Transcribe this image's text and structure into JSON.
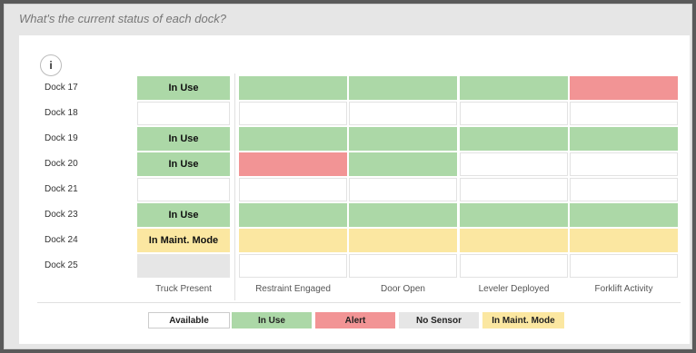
{
  "question": "What's the current status of each dock?",
  "info_icon_glyph": "i",
  "docks": [
    {
      "label": "Dock 17",
      "truck_status": "In Use"
    },
    {
      "label": "Dock 18",
      "truck_status": ""
    },
    {
      "label": "Dock 19",
      "truck_status": "In Use"
    },
    {
      "label": "Dock 20",
      "truck_status": "In Use"
    },
    {
      "label": "Dock 21",
      "truck_status": ""
    },
    {
      "label": "Dock 23",
      "truck_status": "In Use"
    },
    {
      "label": "Dock 24",
      "truck_status": "In Maint. Mode"
    },
    {
      "label": "Dock 25",
      "truck_status": ""
    }
  ],
  "columns": [
    "Truck Present",
    "Restraint Engaged",
    "Door Open",
    "Leveler Deployed",
    "Forklift Activity"
  ],
  "grid_states": [
    [
      "in_use",
      "in_use",
      "in_use",
      "in_use",
      "alert"
    ],
    [
      "available",
      "available",
      "available",
      "available",
      "available"
    ],
    [
      "in_use",
      "in_use",
      "in_use",
      "in_use",
      "in_use"
    ],
    [
      "in_use",
      "alert",
      "in_use",
      "available",
      "available"
    ],
    [
      "available",
      "available",
      "available",
      "available",
      "available"
    ],
    [
      "in_use",
      "in_use",
      "in_use",
      "in_use",
      "in_use"
    ],
    [
      "maint",
      "maint",
      "maint",
      "maint",
      "maint"
    ],
    [
      "no_sensor",
      "available",
      "available",
      "available",
      "available"
    ]
  ],
  "legend": [
    {
      "state": "available",
      "label": "Available"
    },
    {
      "state": "in_use",
      "label": "In Use"
    },
    {
      "state": "alert",
      "label": "Alert"
    },
    {
      "state": "no_sensor",
      "label": "No Sensor"
    },
    {
      "state": "maint",
      "label": "In Maint. Mode"
    }
  ],
  "colors": {
    "available": "#ffffff",
    "in_use": "#acd8a7",
    "alert": "#f29495",
    "no_sensor": "#e6e6e6",
    "maint": "#fbe7a1"
  }
}
